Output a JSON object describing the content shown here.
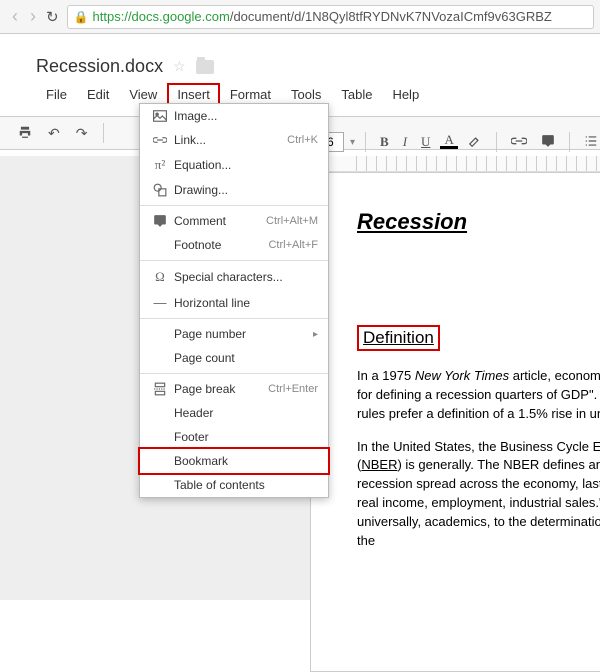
{
  "browser": {
    "url_host": "https://docs.google.com",
    "url_path": "/document/d/1N8Qyl8tfRYDNvK7NVozaICmf9v63GRBZ"
  },
  "doc": {
    "title": "Recession.docx"
  },
  "menubar": [
    "File",
    "Edit",
    "View",
    "Insert",
    "Format",
    "Tools",
    "Table",
    "Help"
  ],
  "menubar_active": "Insert",
  "toolbar": {
    "fontsize": "16"
  },
  "dropdown": {
    "groups": [
      [
        {
          "icon": "image",
          "label": "Image..."
        },
        {
          "icon": "link",
          "label": "Link...",
          "shortcut": "Ctrl+K"
        },
        {
          "icon": "equation",
          "label": "Equation..."
        },
        {
          "icon": "drawing",
          "label": "Drawing..."
        }
      ],
      [
        {
          "icon": "comment",
          "label": "Comment",
          "shortcut": "Ctrl+Alt+M"
        },
        {
          "icon": "",
          "label": "Footnote",
          "shortcut": "Ctrl+Alt+F"
        }
      ],
      [
        {
          "icon": "special",
          "label": "Special characters..."
        },
        {
          "icon": "hr",
          "label": "Horizontal line"
        }
      ],
      [
        {
          "icon": "",
          "label": "Page number",
          "submenu": true
        },
        {
          "icon": "",
          "label": "Page count"
        }
      ],
      [
        {
          "icon": "pagebreak",
          "label": "Page break",
          "shortcut": "Ctrl+Enter"
        },
        {
          "icon": "",
          "label": "Header"
        },
        {
          "icon": "",
          "label": "Footer"
        },
        {
          "icon": "",
          "label": "Bookmark",
          "highlight": true
        },
        {
          "icon": "",
          "label": "Table of contents"
        }
      ]
    ]
  },
  "document": {
    "heading": "Recession",
    "def_label": "Definition",
    "p1_a": "In a 1975 ",
    "p1_it": "New York Times",
    "p1_b": " article, economic rules of thumb for defining a recession quarters of GDP\". In time, the other rules prefer a definition of a 1.5% rise in unemployment",
    "p2_a": "In the United States, the Business Cycle Economic Research (",
    "p2_u": "NBER",
    "p2_b": ") is generally. The NBER defines an economic recession spread across the economy, lasting more GDP, real income, employment, industrial sales.\" Almost universally, academics, to the determination by the NBER for the"
  }
}
